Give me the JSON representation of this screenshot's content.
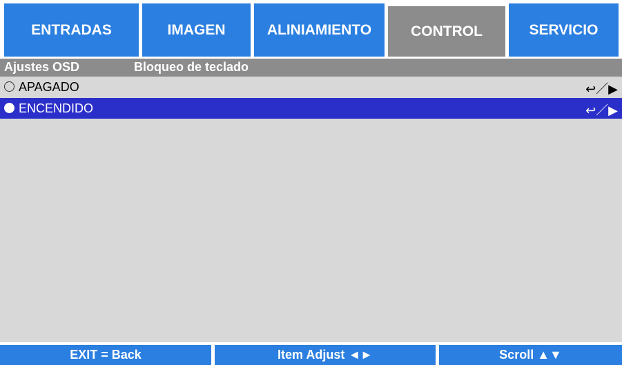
{
  "tabs": [
    {
      "label": "ENTRADAS",
      "active": false
    },
    {
      "label": "IMAGEN",
      "active": false
    },
    {
      "label": "ALINIAMIENTO",
      "active": false
    },
    {
      "label": "CONTROL",
      "active": true
    },
    {
      "label": "SERVICIO",
      "active": false
    }
  ],
  "breadcrumb": {
    "section": "Ajustes OSD",
    "page": "Bloqueo de teclado"
  },
  "options": [
    {
      "label": "APAGADO",
      "hint": "↩／▶",
      "selected": false
    },
    {
      "label": "ENCENDIDO",
      "hint": "↩／▶",
      "selected": true
    }
  ],
  "footer": {
    "back": "EXIT = Back",
    "adjust": "Item Adjust ◄►",
    "scroll": "Scroll ▲▼"
  },
  "colors": {
    "tab": "#2b7fe0",
    "active_tab": "#8c8c8c",
    "title_bar": "#8c8c8c",
    "content_bg": "#d8d8d8",
    "selected_row": "#2b2fc9"
  }
}
